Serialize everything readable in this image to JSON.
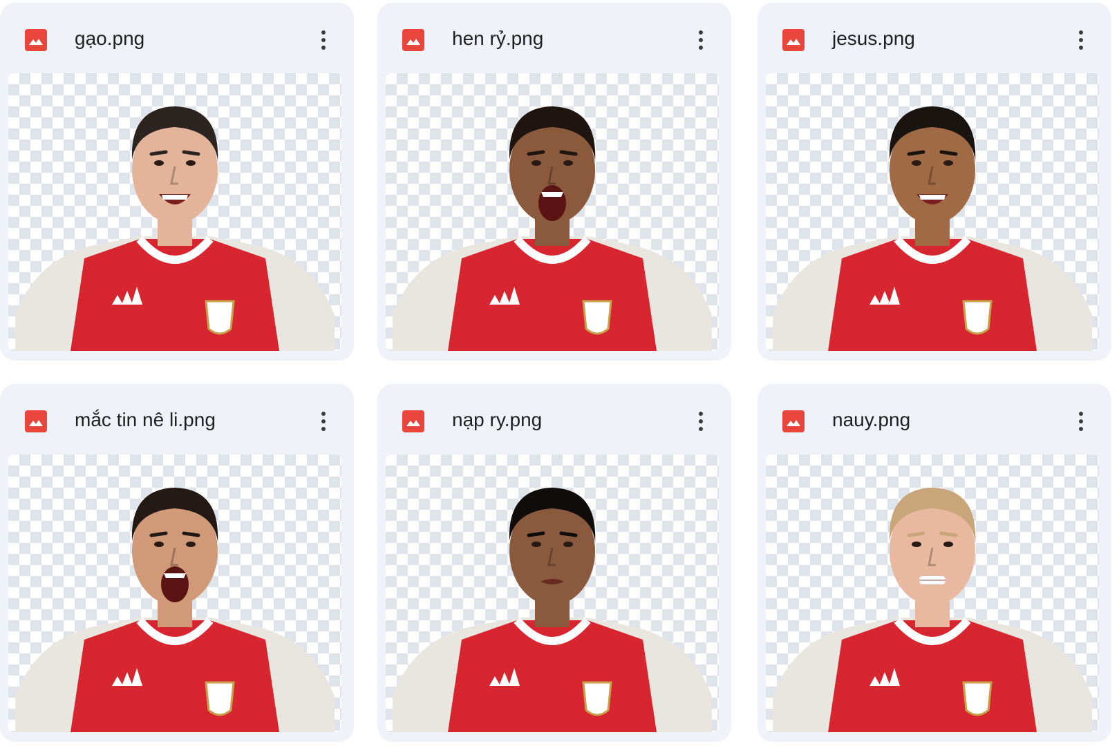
{
  "files": [
    {
      "name": "gạo.png",
      "icon": "image-file-icon",
      "menu_icon": "more-vert-icon",
      "skin": "#e3b49a",
      "hair": "#2b2420",
      "mouth": "smile"
    },
    {
      "name": "hen rỷ.png",
      "icon": "image-file-icon",
      "menu_icon": "more-vert-icon",
      "skin": "#8b5a3c",
      "hair": "#1e1510",
      "mouth": "shout"
    },
    {
      "name": "jesus.png",
      "icon": "image-file-icon",
      "menu_icon": "more-vert-icon",
      "skin": "#a06a45",
      "hair": "#1a1410",
      "mouth": "smile"
    },
    {
      "name": "mắc tin nê li.png",
      "icon": "image-file-icon",
      "menu_icon": "more-vert-icon",
      "skin": "#d09a78",
      "hair": "#231a15",
      "mouth": "shout"
    },
    {
      "name": "nạp ry.png",
      "icon": "image-file-icon",
      "menu_icon": "more-vert-icon",
      "skin": "#8a5a3e",
      "hair": "#0f0c0a",
      "mouth": "closed"
    },
    {
      "name": "nauy.png",
      "icon": "image-file-icon",
      "menu_icon": "more-vert-icon",
      "skin": "#e8b9a0",
      "hair": "#c9a57a",
      "mouth": "grit"
    }
  ],
  "colors": {
    "card_bg": "#eff2f8",
    "file_icon": "#e8453c",
    "jersey_red": "#d7262f",
    "jersey_sleeve": "#e9e6df"
  }
}
